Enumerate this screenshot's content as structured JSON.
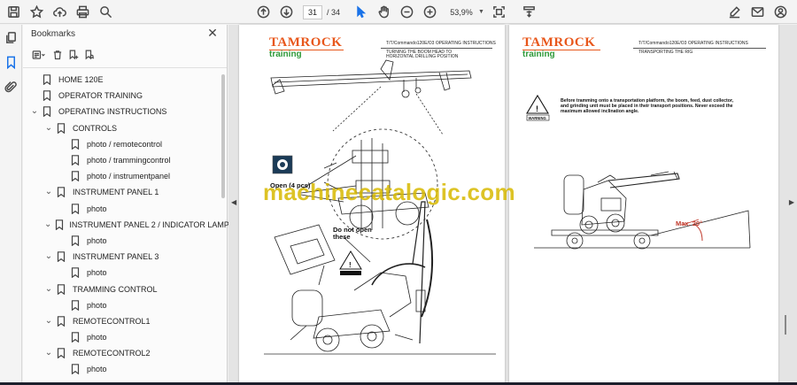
{
  "toolbar": {
    "current_page": "31",
    "total_pages": "/ 34",
    "zoom": "53,9%"
  },
  "bookmarks": {
    "title": "Bookmarks",
    "items": [
      {
        "label": "HOME 120E",
        "depth": 0,
        "expanded": null
      },
      {
        "label": "OPERATOR TRAINING",
        "depth": 0,
        "expanded": null
      },
      {
        "label": "OPERATING INSTRUCTIONS",
        "depth": 0,
        "expanded": true
      },
      {
        "label": "CONTROLS",
        "depth": 1,
        "expanded": true
      },
      {
        "label": "photo / remotecontrol",
        "depth": 2,
        "expanded": null
      },
      {
        "label": "photo / trammingcontrol",
        "depth": 2,
        "expanded": null
      },
      {
        "label": "photo / instrumentpanel",
        "depth": 2,
        "expanded": null
      },
      {
        "label": "INSTRUMENT PANEL 1",
        "depth": 1,
        "expanded": true
      },
      {
        "label": "photo",
        "depth": 2,
        "expanded": null
      },
      {
        "label": "INSTRUMENT PANEL 2 / INDICATOR LAMPS",
        "depth": 1,
        "expanded": true
      },
      {
        "label": "photo",
        "depth": 2,
        "expanded": null
      },
      {
        "label": "INSTRUMENT PANEL 3",
        "depth": 1,
        "expanded": true
      },
      {
        "label": "photo",
        "depth": 2,
        "expanded": null
      },
      {
        "label": "TRAMMING CONTROL",
        "depth": 1,
        "expanded": true
      },
      {
        "label": "photo",
        "depth": 2,
        "expanded": null
      },
      {
        "label": "REMOTECONTROL1",
        "depth": 1,
        "expanded": true
      },
      {
        "label": "photo",
        "depth": 2,
        "expanded": null
      },
      {
        "label": "REMOTECONTROL2",
        "depth": 1,
        "expanded": true
      },
      {
        "label": "photo",
        "depth": 2,
        "expanded": null
      }
    ]
  },
  "page_left": {
    "logo": "TAMROCK",
    "subtitle": "training",
    "code": "T/T/Commando120E/O3 OPERATING INSTRUCTIONS",
    "heading_line1": "TURNING THE BOOM HEAD TO",
    "heading_line2": "HORIZONTAL DRILLING POSITION",
    "label_open": "Open (4 pcs)",
    "label_do_not_open": "Do not open these"
  },
  "page_right": {
    "logo": "TAMROCK",
    "subtitle": "training",
    "code": "T/T/Commando120E/O3 OPERATING INSTRUCTIONS",
    "heading": "TRANSPORTING THE RIG",
    "warning_sign": "WARNING",
    "warning_text": "Before tramming onto a transportation platform, the boom, feed, dust collector, and grinding unit must be placed in their transport positions. Never exceed the maximum allowed inclination angle.",
    "angle_label": "Max. 20°"
  },
  "watermark": "machinecatalogic.com",
  "colors": {
    "logo": "#e8571b",
    "training": "#2f9a3a",
    "accent": "#1a73e8",
    "watermark": "#d7b900"
  }
}
